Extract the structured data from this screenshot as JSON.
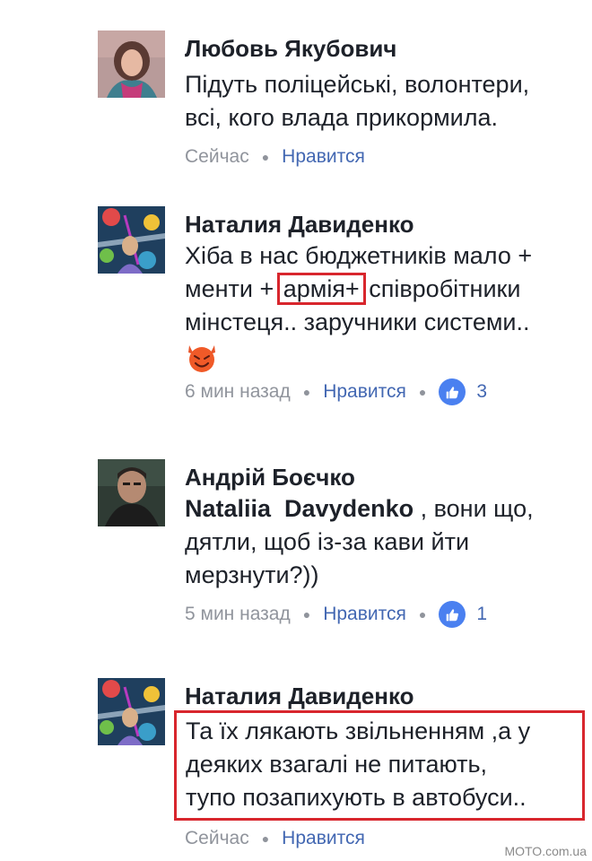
{
  "comments": [
    {
      "author": "Любовь Якубович",
      "lines": [
        "Підуть поліцейські, волонтери,",
        "всі, кого влада прикормила."
      ],
      "time": "Сейчас",
      "like_label": "Нравится",
      "like_count": null
    },
    {
      "author": "Наталия Давиденко",
      "line1": "Хіба в нас бюджетників мало +",
      "line2_pre": "менти + ",
      "line2_highlight": "армія+",
      "line2_post": " співробітники",
      "line3": "мінстеця.. заручники системи..",
      "emoji": "smiling-devil-emoji",
      "time": "6 мин назад",
      "like_label": "Нравится",
      "like_count": "3"
    },
    {
      "author": "Андрій Боєчко",
      "mention": "Nataliia  Davydenko",
      "line1_post": " , вони що,",
      "lines": [
        "дятли, щоб із-за кави йти",
        "мерзнути?))"
      ],
      "time": "5 мин назад",
      "like_label": "Нравится",
      "like_count": "1"
    },
    {
      "author": "Наталия Давиденко",
      "lines": [
        "Та їх лякають звільненням ,а у",
        "деяких взагалі не питають,",
        "тупо позапихують в автобуси.."
      ],
      "time": "Сейчас",
      "like_label": "Нравится",
      "like_count": null
    }
  ],
  "colors": {
    "text": "#1d2129",
    "meta": "#90949c",
    "link": "#4267b2",
    "like_badge": "#4a80f0",
    "highlight_border": "#d8262d"
  },
  "watermark": "MOTO.com.ua"
}
